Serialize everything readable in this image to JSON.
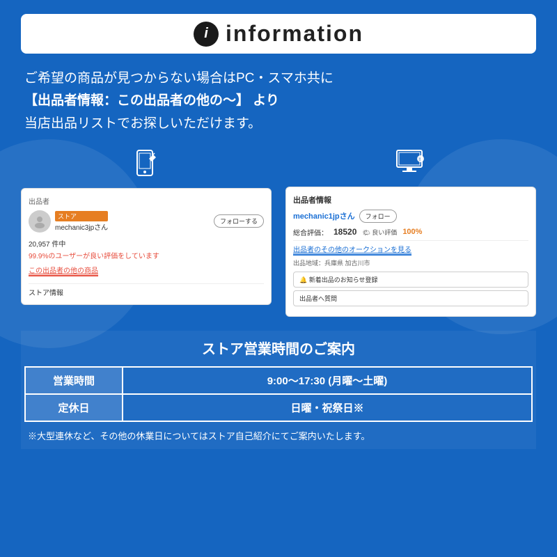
{
  "header": {
    "icon_label": "i",
    "title": "information"
  },
  "description": {
    "line1": "ご希望の商品が見つからない場合はPC・スマホ共に",
    "line2": "【出品者情報：この出品者の他の〜】 より",
    "line3": "当店出品リストでお探しいただけます。"
  },
  "left_panel": {
    "device_icon": "📱",
    "section_label": "出品者",
    "store_badge": "ストア",
    "seller_name": "mechanic3jpさん",
    "follow_btn": "フォローする",
    "count": "20,957 件中",
    "rating": "99.9%のユーザーが良い評価をしています",
    "link": "この出品者の他の商品",
    "store_info": "ストア情報"
  },
  "right_panel": {
    "device_icon": "💻",
    "title": "出品者情報",
    "seller_name": "mechanic1jpさん",
    "follow_btn": "フォロー",
    "rating_label": "総合評価：",
    "rating_number": "18520",
    "good_label": "🌤 良い評価",
    "rating_pct": "100%",
    "auction_link": "出品者のその他のオークションを見る",
    "location_label": "出品地域：兵庫県 加古川市",
    "notify_btn": "🔔 新着出品のお知らせ登録",
    "question_btn": "出品者へ質問"
  },
  "store_hours": {
    "title": "ストア営業時間のご案内",
    "rows": [
      {
        "label": "営業時間",
        "value": "9:00〜17:30 (月曜〜土曜)"
      },
      {
        "label": "定休日",
        "value": "日曜・祝祭日※"
      }
    ],
    "footer_note": "※大型連休など、その他の休業日についてはストア自己紹介にてご案内いたします。"
  }
}
